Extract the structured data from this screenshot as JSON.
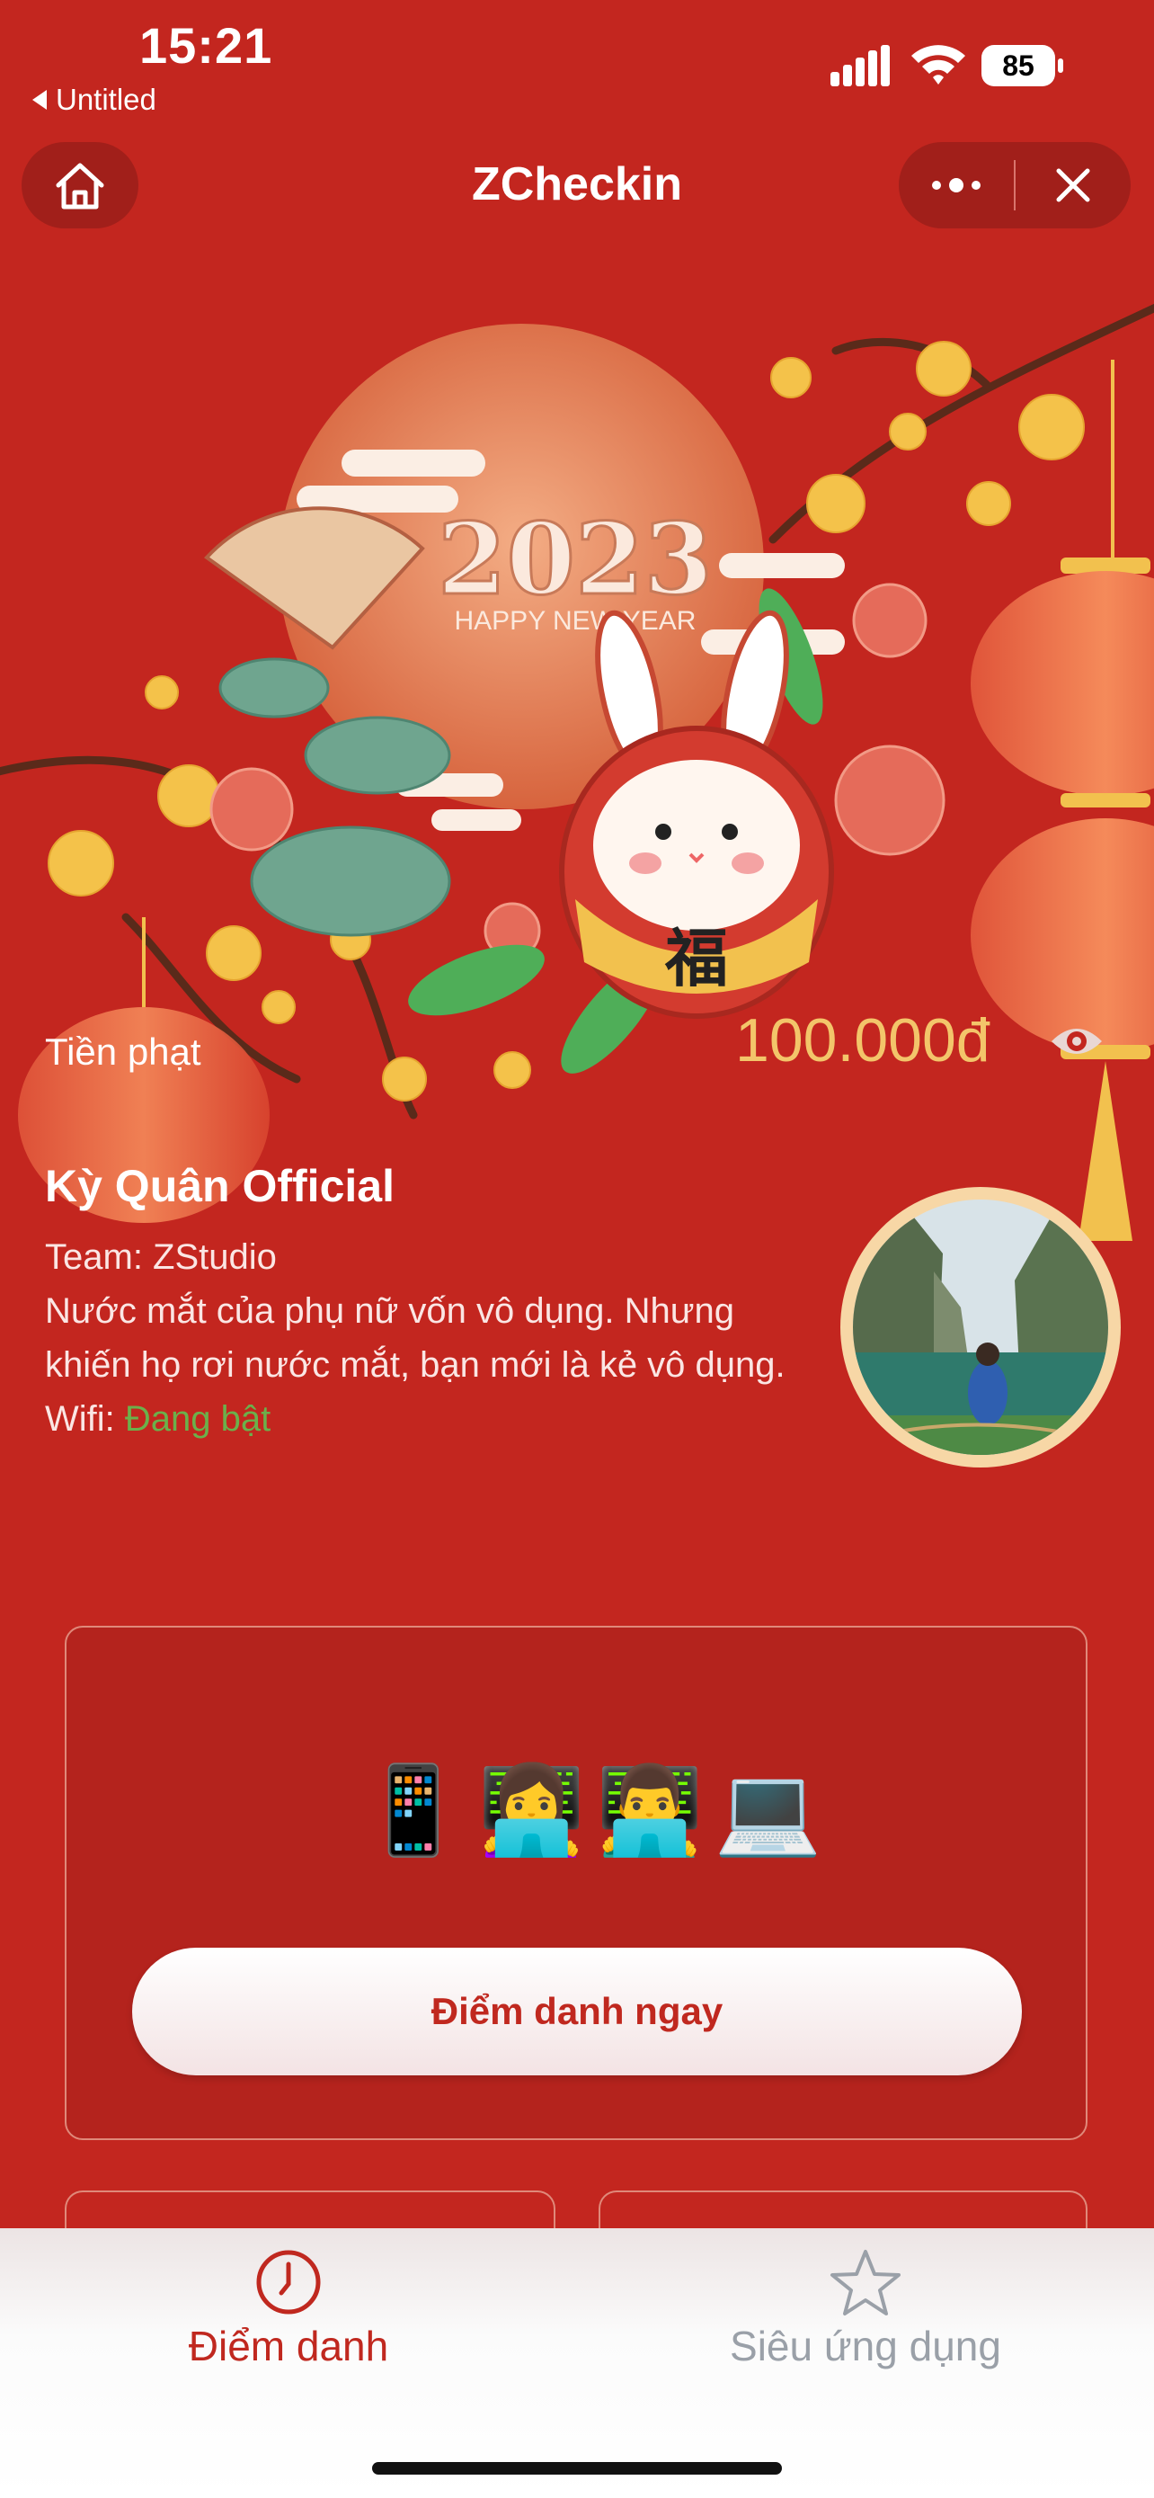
{
  "status_bar": {
    "time": "15:21",
    "back_app": "Untitled",
    "battery": "85"
  },
  "nav": {
    "title": "ZCheckin"
  },
  "banner": {
    "year": "2023",
    "greeting": "HAPPY NEW YEAR",
    "fu_char": "福"
  },
  "fine": {
    "label": "Tiền phạt",
    "amount": "100.000đ"
  },
  "profile": {
    "name": "Kỳ Quân Official",
    "team": "Team: ZStudio",
    "bio": "Nước mắt của phụ nữ vốn vô dụng. Nhưng khiến họ rơi nước mắt, bạn mới là kẻ vô dụng.",
    "wifi_label": "Wifi:",
    "wifi_status": "Đang bật"
  },
  "checkin": {
    "emojis": [
      "📱",
      "👩‍💻",
      "👨‍💻",
      "💻"
    ],
    "button_label": "Điểm danh ngay"
  },
  "tabs": [
    {
      "label": "Điểm danh",
      "icon": "clock-icon",
      "active": true
    },
    {
      "label": "Siêu ứng dụng",
      "icon": "star-icon",
      "active": false
    }
  ],
  "colors": {
    "background": "#c3261f",
    "accent": "#c0281f",
    "gold": "#f3c56a",
    "wifi_on": "#6bb04b"
  }
}
